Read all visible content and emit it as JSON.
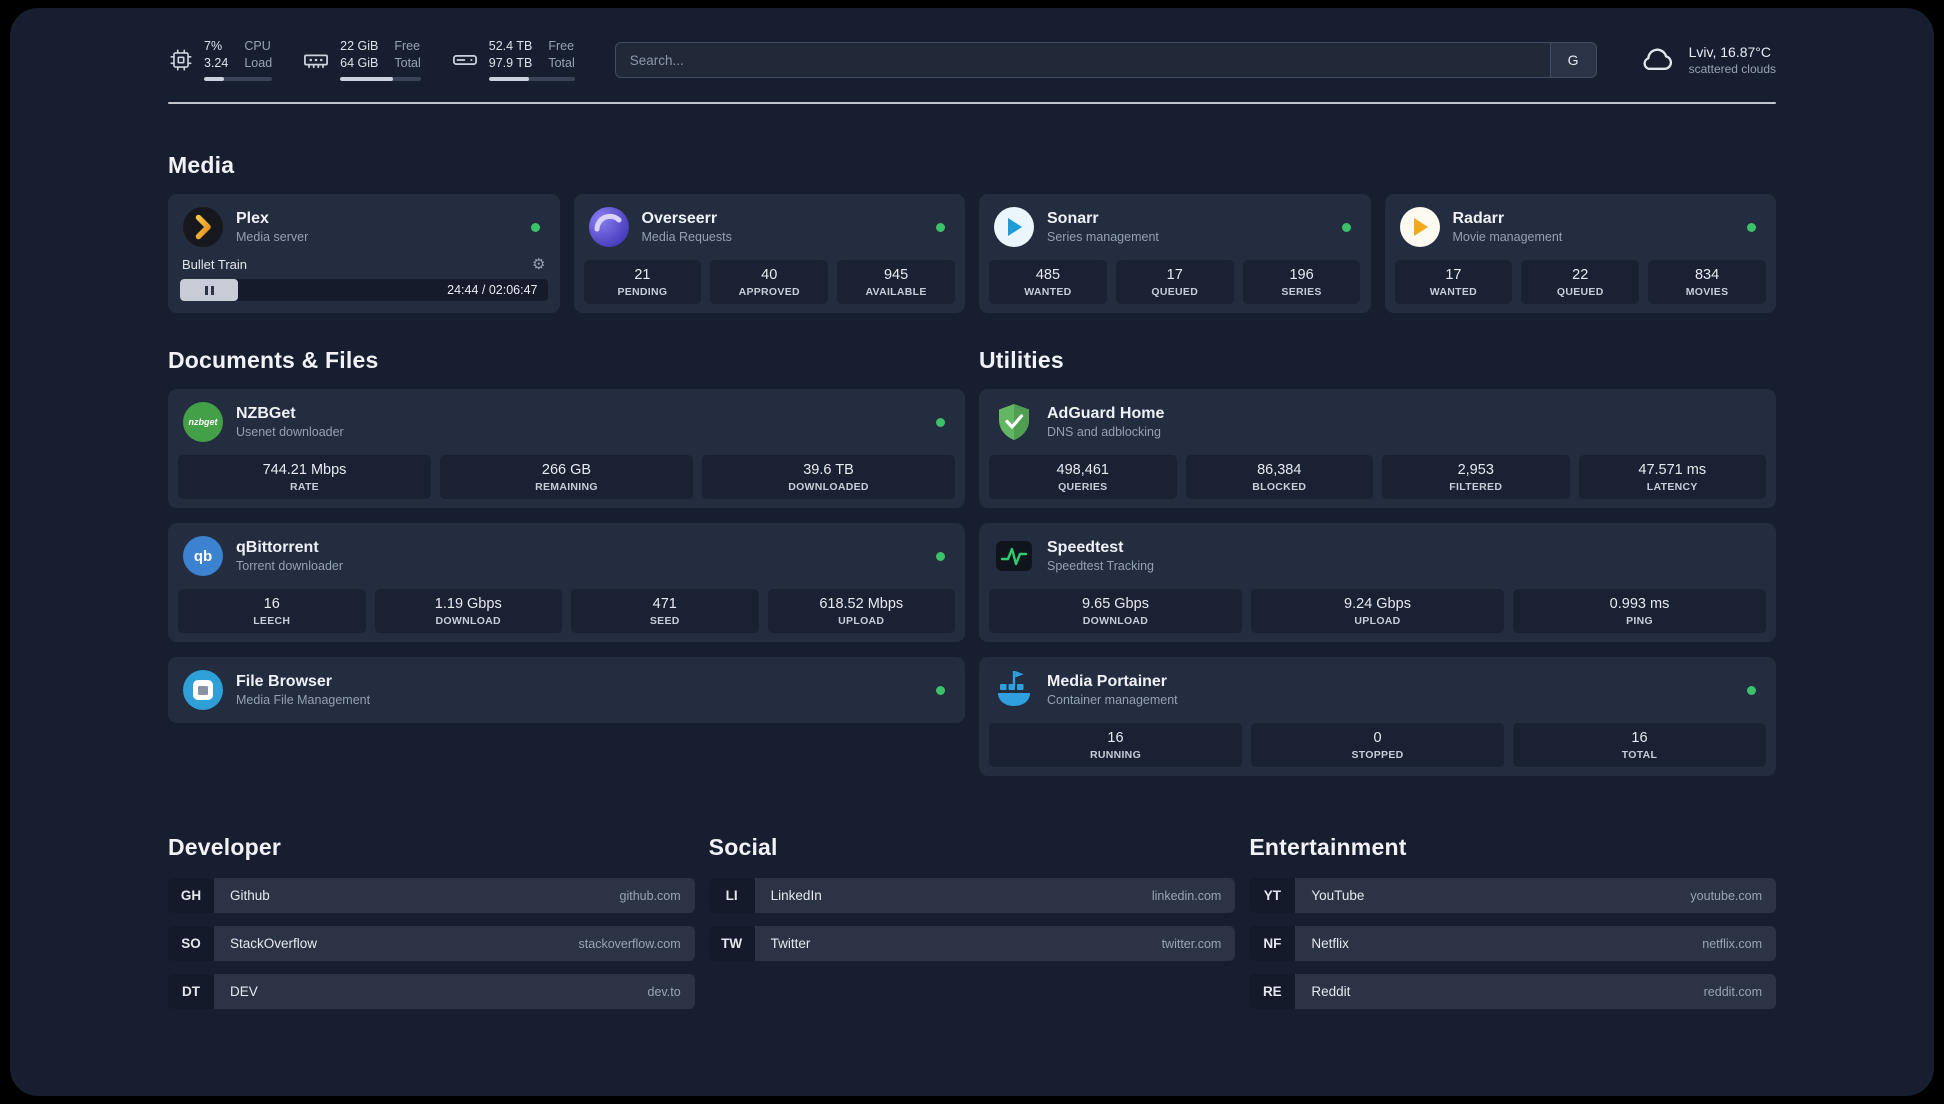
{
  "colors": {
    "status_online": "#3cc06a",
    "accent_bar": "#ccd2dd",
    "background": "#171e30",
    "card": "#242c3f"
  },
  "topbar": {
    "cpu": {
      "value1": "7%",
      "label1": "CPU",
      "value2": "3.24",
      "label2": "Load"
    },
    "memory": {
      "value1": "22 GiB",
      "label1": "Free",
      "value2": "64 GiB",
      "label2": "Total"
    },
    "disk": {
      "value1": "52.4 TB",
      "label1": "Free",
      "value2": "97.9 TB",
      "label2": "Total"
    },
    "search": {
      "placeholder": "Search...",
      "provider": "G"
    },
    "weather": {
      "location": "Lviv, 16.87°C",
      "condition": "scattered clouds"
    }
  },
  "sections": {
    "media": {
      "title": "Media",
      "plex": {
        "title": "Plex",
        "subtitle": "Media server",
        "now_playing": "Bullet Train",
        "time": "24:44 / 02:06:47"
      },
      "overseerr": {
        "title": "Overseerr",
        "subtitle": "Media Requests",
        "stats": [
          {
            "value": "21",
            "label": "PENDING"
          },
          {
            "value": "40",
            "label": "APPROVED"
          },
          {
            "value": "945",
            "label": "AVAILABLE"
          }
        ]
      },
      "sonarr": {
        "title": "Sonarr",
        "subtitle": "Series management",
        "stats": [
          {
            "value": "485",
            "label": "WANTED"
          },
          {
            "value": "17",
            "label": "QUEUED"
          },
          {
            "value": "196",
            "label": "SERIES"
          }
        ]
      },
      "radarr": {
        "title": "Radarr",
        "subtitle": "Movie management",
        "stats": [
          {
            "value": "17",
            "label": "WANTED"
          },
          {
            "value": "22",
            "label": "QUEUED"
          },
          {
            "value": "834",
            "label": "MOVIES"
          }
        ]
      }
    },
    "documents": {
      "title": "Documents & Files",
      "nzbget": {
        "title": "NZBGet",
        "subtitle": "Usenet downloader",
        "stats": [
          {
            "value": "744.21 Mbps",
            "label": "RATE"
          },
          {
            "value": "266 GB",
            "label": "REMAINING"
          },
          {
            "value": "39.6 TB",
            "label": "DOWNLOADED"
          }
        ]
      },
      "qbittorrent": {
        "title": "qBittorrent",
        "subtitle": "Torrent downloader",
        "stats": [
          {
            "value": "16",
            "label": "LEECH"
          },
          {
            "value": "1.19 Gbps",
            "label": "DOWNLOAD"
          },
          {
            "value": "471",
            "label": "SEED"
          },
          {
            "value": "618.52 Mbps",
            "label": "UPLOAD"
          }
        ]
      },
      "filebrowser": {
        "title": "File Browser",
        "subtitle": "Media File Management"
      }
    },
    "utilities": {
      "title": "Utilities",
      "adguard": {
        "title": "AdGuard Home",
        "subtitle": "DNS and adblocking",
        "stats": [
          {
            "value": "498,461",
            "label": "QUERIES"
          },
          {
            "value": "86,384",
            "label": "BLOCKED"
          },
          {
            "value": "2,953",
            "label": "FILTERED"
          },
          {
            "value": "47.571 ms",
            "label": "LATENCY"
          }
        ]
      },
      "speedtest": {
        "title": "Speedtest",
        "subtitle": "Speedtest Tracking",
        "stats": [
          {
            "value": "9.65 Gbps",
            "label": "DOWNLOAD"
          },
          {
            "value": "9.24 Gbps",
            "label": "UPLOAD"
          },
          {
            "value": "0.993 ms",
            "label": "PING"
          }
        ]
      },
      "portainer": {
        "title": "Media Portainer",
        "subtitle": "Container management",
        "stats": [
          {
            "value": "16",
            "label": "RUNNING"
          },
          {
            "value": "0",
            "label": "STOPPED"
          },
          {
            "value": "16",
            "label": "TOTAL"
          }
        ]
      }
    }
  },
  "bookmarks": {
    "developer": {
      "title": "Developer",
      "items": [
        {
          "abbr": "GH",
          "name": "Github",
          "url": "github.com"
        },
        {
          "abbr": "SO",
          "name": "StackOverflow",
          "url": "stackoverflow.com"
        },
        {
          "abbr": "DT",
          "name": "DEV",
          "url": "dev.to"
        }
      ]
    },
    "social": {
      "title": "Social",
      "items": [
        {
          "abbr": "LI",
          "name": "LinkedIn",
          "url": "linkedin.com"
        },
        {
          "abbr": "TW",
          "name": "Twitter",
          "url": "twitter.com"
        }
      ]
    },
    "entertainment": {
      "title": "Entertainment",
      "items": [
        {
          "abbr": "YT",
          "name": "YouTube",
          "url": "youtube.com"
        },
        {
          "abbr": "NF",
          "name": "Netflix",
          "url": "netflix.com"
        },
        {
          "abbr": "RE",
          "name": "Reddit",
          "url": "reddit.com"
        }
      ]
    }
  }
}
